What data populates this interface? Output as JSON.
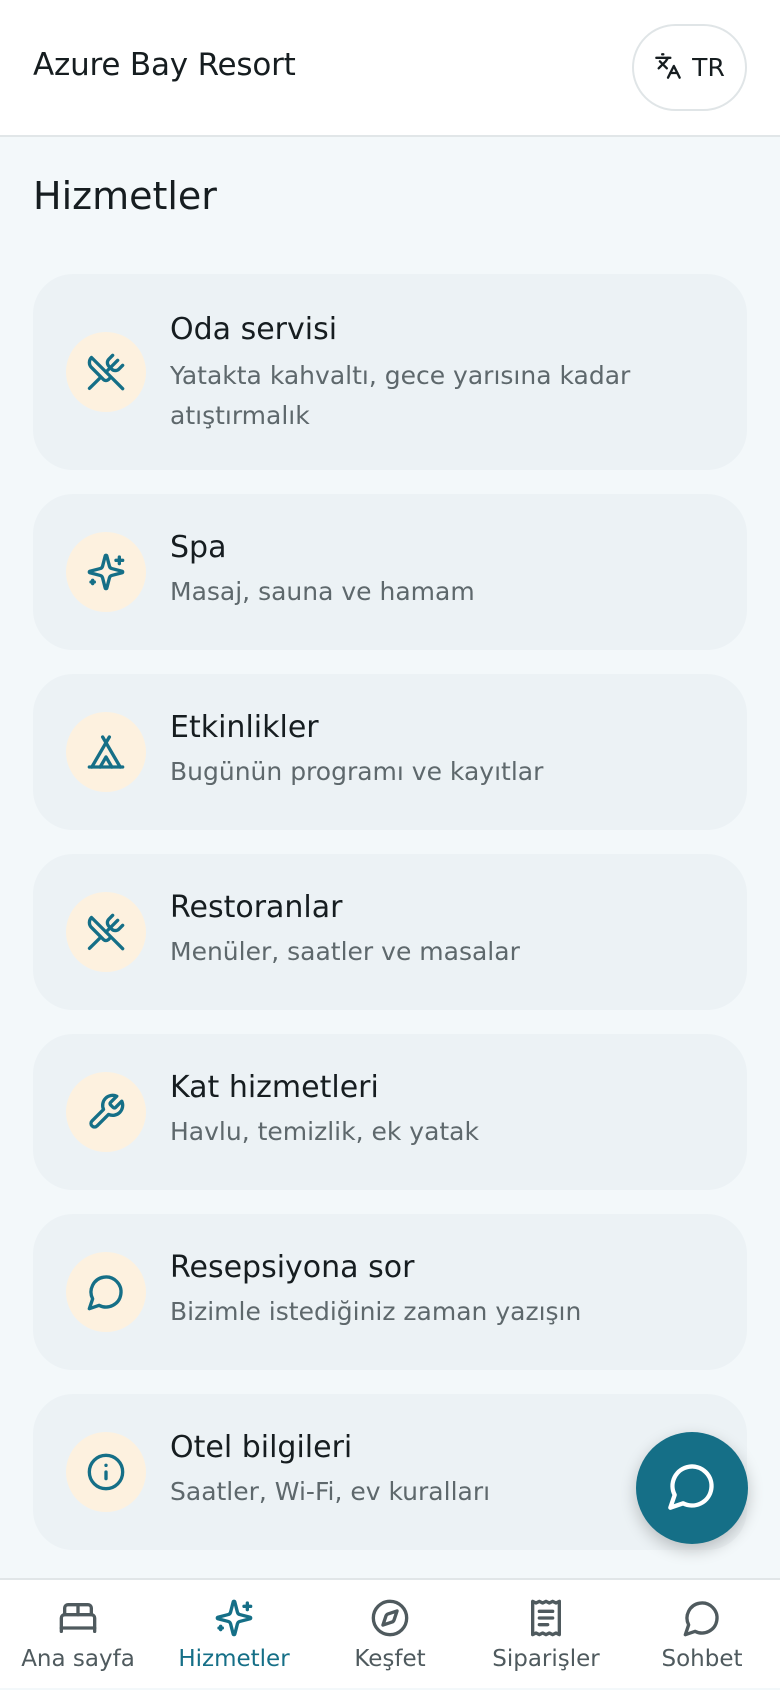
{
  "header": {
    "app_title": "Azure Bay Resort",
    "language": {
      "label": "TR",
      "icon": "translate-icon"
    }
  },
  "page_title": "Hizmetler",
  "services": [
    {
      "title": "Oda servisi",
      "subtitle": "Yatakta kahvaltı, gece yarısına kadar atıştırmalık",
      "icon": "utensils-crossed-icon"
    },
    {
      "title": "Spa",
      "subtitle": "Masaj, sauna ve hamam",
      "icon": "sparkles-icon"
    },
    {
      "title": "Etkinlikler",
      "subtitle": "Bugünün programı ve kayıtlar",
      "icon": "tent-icon"
    },
    {
      "title": "Restoranlar",
      "subtitle": "Menüler, saatler ve masalar",
      "icon": "utensils-crossed-icon"
    },
    {
      "title": "Kat hizmetleri",
      "subtitle": "Havlu, temizlik, ek yatak",
      "icon": "wrench-icon"
    },
    {
      "title": "Resepsiyona sor",
      "subtitle": "Bizimle istediğiniz zaman yazışın",
      "icon": "message-circle-icon"
    },
    {
      "title": "Otel bilgileri",
      "subtitle": "Saatler, Wi-Fi, ev kuralları",
      "icon": "info-icon"
    }
  ],
  "fab": {
    "icon": "chat-bubble-icon"
  },
  "tabs": [
    {
      "label": "Ana sayfa",
      "icon": "bed-icon",
      "active": false
    },
    {
      "label": "Hizmetler",
      "icon": "sparkles-icon",
      "active": true
    },
    {
      "label": "Keşfet",
      "icon": "compass-icon",
      "active": false
    },
    {
      "label": "Siparişler",
      "icon": "receipt-icon",
      "active": false
    },
    {
      "label": "Sohbet",
      "icon": "message-circle-icon",
      "active": false
    }
  ],
  "colors": {
    "accent": "#156f87",
    "icon_bg": "#fdf1df",
    "card_bg": "#ecf2f5",
    "page_bg": "#f3f8fa",
    "inactive": "#4f5a5e"
  }
}
